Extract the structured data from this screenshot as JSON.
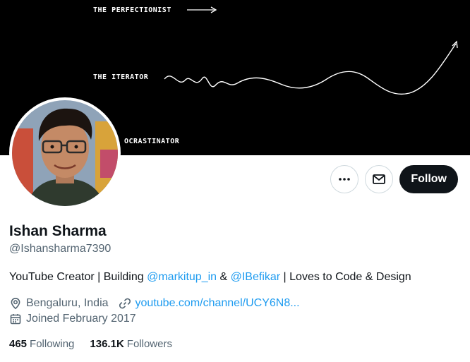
{
  "banner": {
    "line1": "THE PERFECTIONIST",
    "line2": "THE ITERATOR",
    "line3": "OCRASTINATOR"
  },
  "profile": {
    "name": "Ishan Sharma",
    "handle": "@Ishansharma7390",
    "bio_text1": "YouTube Creator | Building ",
    "bio_link1": "@markitup_in",
    "bio_text2": " & ",
    "bio_link2": "@IBefikar",
    "bio_text3": " | Loves to Code & Design",
    "location": "Bengaluru, India",
    "website": "youtube.com/channel/UCY6N8...",
    "joined": "Joined February 2017"
  },
  "actions": {
    "more_icon": "more-icon",
    "message_icon": "envelope-icon",
    "follow_label": "Follow"
  },
  "stats": {
    "following_count": "465",
    "following_label": "Following",
    "followers_count": "136.1K",
    "followers_label": "Followers"
  }
}
